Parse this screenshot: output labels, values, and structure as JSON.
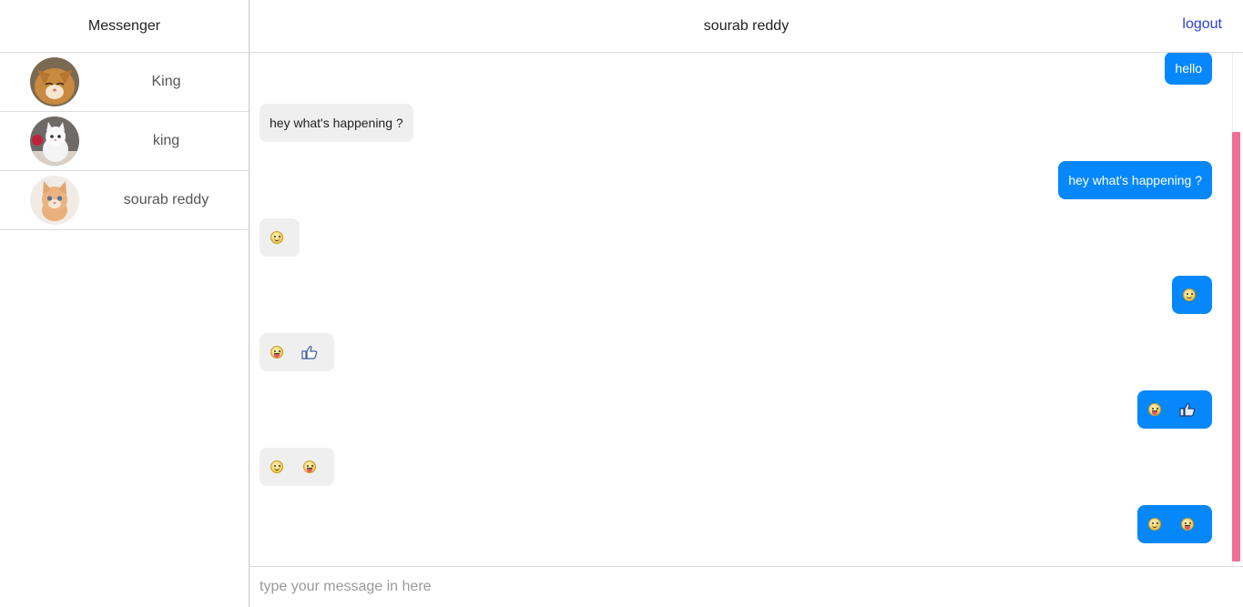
{
  "sidebar": {
    "title": "Messenger",
    "contacts": [
      {
        "name": "King"
      },
      {
        "name": "king"
      },
      {
        "name": "sourab reddy"
      }
    ]
  },
  "header": {
    "title": "sourab reddy",
    "logout_label": "logout"
  },
  "messages": [
    {
      "direction": "out",
      "text": "hello"
    },
    {
      "direction": "in",
      "text": "hey what's happening ?"
    },
    {
      "direction": "out",
      "text": "hey what's happening ?"
    },
    {
      "direction": "in",
      "icons": [
        "smile-emoji"
      ]
    },
    {
      "direction": "out",
      "icons": [
        "smile-emoji"
      ]
    },
    {
      "direction": "in",
      "icons": [
        "tongue-emoji",
        "thumbs-up"
      ]
    },
    {
      "direction": "out",
      "icons": [
        "tongue-emoji",
        "thumbs-up"
      ]
    },
    {
      "direction": "in",
      "icons": [
        "smile-emoji",
        "tongue-emoji"
      ]
    },
    {
      "direction": "out",
      "icons": [
        "smile-emoji",
        "tongue-emoji"
      ]
    }
  ],
  "composer": {
    "placeholder": "type your message in here"
  },
  "colors": {
    "outgoing_bubble": "#0787fc",
    "incoming_bubble": "#efefef",
    "logout_link": "#2d3ee0",
    "scrollbar_thumb": "#ee6e94"
  }
}
